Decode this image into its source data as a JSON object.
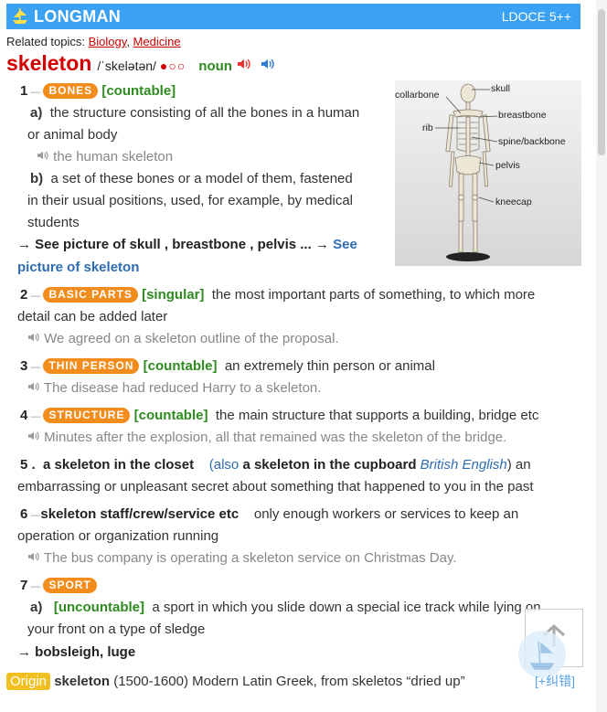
{
  "header": {
    "brand": "LONGMAN",
    "edition": "LDOCE 5++"
  },
  "topics": {
    "label": "Related topics:",
    "items": [
      "Biology",
      "Medicine"
    ]
  },
  "headword": {
    "word": "skeleton",
    "pron": "/ˈskelətən/",
    "freq": "●○○",
    "pos": "noun"
  },
  "senses": {
    "s1": {
      "num": "1",
      "signpost": "BONES",
      "gram": "[countable]",
      "a_label": "a)",
      "a_def1": "the structure consisting of all the bones in a human",
      "a_def2": "or animal body",
      "a_ex": "the human skeleton",
      "b_label": "b)",
      "b_def1": "a set of these bones or a model of them, fastened",
      "b_def2": "in their usual positions, used, for example, by medical",
      "b_def3": "students",
      "see1": "→ See picture of skull , breastbone , pelvis ... →",
      "see_link1": "See",
      "see_link2": "picture of skeleton"
    },
    "s2": {
      "num": "2",
      "signpost": "BASIC PARTS",
      "gram": "[singular]",
      "def1": "the most important parts of something, to which more",
      "def2": "detail can be added later",
      "ex": "We agreed on a skeleton outline of the proposal."
    },
    "s3": {
      "num": "3",
      "signpost": "THIN PERSON",
      "gram": "[countable]",
      "def1": "an extremely thin person or animal",
      "ex": "The disease had reduced Harry to a skeleton."
    },
    "s4": {
      "num": "4",
      "signpost": "STRUCTURE",
      "gram": "[countable]",
      "def1": "the main structure that supports a building, bridge etc",
      "ex": "Minutes after the explosion, all that remained was the skeleton of the bridge."
    },
    "s5": {
      "num": "5 .",
      "lex": "a skeleton in the closet",
      "also": "(also",
      "lex2": "a skeleton in the cupboard",
      "region": "British English",
      "def1": ") an",
      "def2": "embarrassing or unpleasant secret about something that happened to you in the past"
    },
    "s6": {
      "num": "6",
      "lex": "skeleton staff/crew/service etc",
      "def1": "only enough workers or services to keep an",
      "def2": "operation or organization running",
      "ex": "The bus company is operating a skeleton service on Christmas Day."
    },
    "s7": {
      "num": "7",
      "signpost": "SPORT",
      "a_label": "a)",
      "gram": "[uncountable]",
      "def1": "a sport in which you slide down a special ice track while lying on",
      "def2": "your front on a type of sledge",
      "see": "→ bobsleigh, luge"
    }
  },
  "picture": {
    "labels": [
      "skull",
      "collarbone",
      "rib",
      "breastbone",
      "spine/backbone",
      "pelvis",
      "kneecap"
    ]
  },
  "origin": {
    "tag": "Origin",
    "word": "skeleton",
    "text": "(1500-1600) Modern Latin Greek, from skeletos “dried up”"
  },
  "fix": {
    "label": "[+纠错]"
  }
}
